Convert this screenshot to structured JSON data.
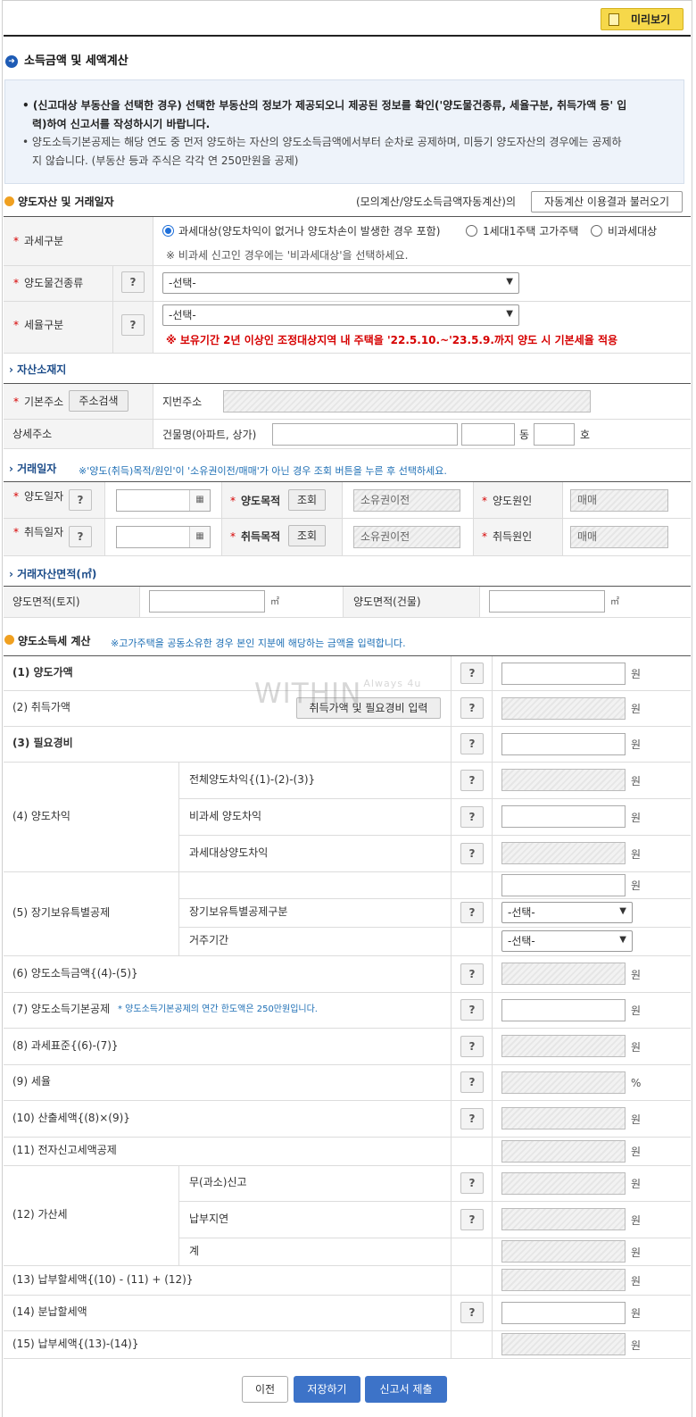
{
  "toolbar": {
    "preview": "미리보기"
  },
  "page": {
    "title": "소득금액 및 세액계산"
  },
  "notice": {
    "n1": "(신고대상 부동산을 선택한 경우) 선택한 부동산의 정보가 제공되오니 제공된 정보를 확인('양도물건종류, 세율구분, 취득가액 등' 입",
    "n1b": "력)하여 신고서를 작성하시기 바랍니다.",
    "n2": "양도소득기본공제는 해당 연도 중 먼저 양도하는 자산의 양도소득금액에서부터 순차로 공제하며, 미등기 양도자산의 경우에는 공제하",
    "n2b": "지 않습니다. (부동산 등과 주식은 각각 연 250만원을 공제)"
  },
  "asset": {
    "heading": "양도자산 및 거래일자",
    "mock": "(모의계산/양도소득금액자동계산)의",
    "auto_btn": "자동계산 이용결과 불러오기",
    "tax_class": "과세구분",
    "r1": "과세대상(양도차익이 없거나 양도차손이 발생한 경우 포함)",
    "r2": "1세대1주택 고가주택",
    "r3": "비과세대상",
    "note": "※ 비과세 신고인 경우에는 '비과세대상'을 선택하세요.",
    "kind": "양도물건종류",
    "rate": "세율구분",
    "select": "-선택-",
    "warn": "※ 보유기간 2년 이상인 조정대상지역 내 주택을 '22.5.10.~'23.5.9.까지 양도 시 기본세율 적용"
  },
  "location": {
    "heading": "자산소재지",
    "basic": "기본주소",
    "search": "주소검색",
    "jibun": "지번주소",
    "detail": "상세주소",
    "building": "건물명(아파트, 상가)",
    "dong": "동",
    "ho": "호"
  },
  "trade": {
    "heading": "거래일자",
    "note": "※'양도(취득)목적/원인'이 '소유권이전/매매'가 아닌 경우 조회 버튼을 누른 후 선택하세요.",
    "transfer_date": "양도일자",
    "acquire_date": "취득일자",
    "transfer_purpose": "양도목적",
    "acquire_purpose": "취득목적",
    "inquiry": "조회",
    "own": "소유권이전",
    "transfer_cause": "양도원인",
    "acquire_cause": "취득원인",
    "sale": "매매",
    "cal": "▦"
  },
  "area": {
    "heading": "거래자산면적(㎡)",
    "land": "양도면적(토지)",
    "building": "양도면적(건물)",
    "unit": "㎡"
  },
  "calc": {
    "heading": "양도소득세 계산",
    "note": "※고가주택을 공동소유한 경우 본인 지분에 해당하는 금액을 입력합니다.",
    "won": "원",
    "pct": "%",
    "r1": "(1) 양도가액",
    "r2": "(2) 취득가액",
    "r2btn": "취득가액 및 필요경비 입력",
    "r3": "(3) 필요경비",
    "r4": "(4) 양도차익",
    "r4a": "전체양도차익{(1)-(2)-(3)}",
    "r4b": "비과세 양도차익",
    "r4c": "과세대상양도차익",
    "r5": "(5) 장기보유특별공제",
    "r5a": "장기보유특별공제구분",
    "r5b": "거주기간",
    "r6": "(6) 양도소득금액{(4)-(5)}",
    "r7": "(7) 양도소득기본공제",
    "r7note": "* 양도소득기본공제의 연간 한도액은 250만원입니다.",
    "r8": "(8) 과세표준{(6)-(7)}",
    "r9": "(9) 세율",
    "r10": "(10) 산출세액{(8)×(9)}",
    "r11": "(11) 전자신고세액공제",
    "r12": "(12) 가산세",
    "r12a": "무(과소)신고",
    "r12b": "납부지연",
    "r12c": "계",
    "r13": "(13) 납부할세액{(10) - (11) + (12)}",
    "r14": "(14) 분납할세액",
    "r15": "(15) 납부세액{(13)-(14)}"
  },
  "watermark": {
    "main": "WITHIN",
    "sub": "Always 4u"
  },
  "footer": {
    "prev": "이전",
    "save": "저장하기",
    "submit": "신고서 제출"
  },
  "q": "?"
}
